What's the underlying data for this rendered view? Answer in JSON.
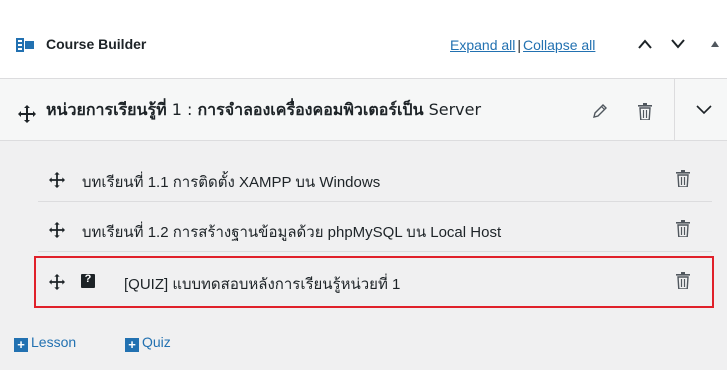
{
  "header": {
    "icon": "course-builder-icon",
    "title": "Course Builder",
    "expand_all": "Expand all",
    "separator": "|",
    "collapse_all": "Collapse all",
    "move_up_icon": "chevron-up-icon",
    "move_down_icon": "chevron-down-icon",
    "collapse_icon": "triangle-up-icon"
  },
  "section": {
    "move_icon": "move-arrows-icon",
    "title_prefix": "หน่วยการเรียนรู้ที่",
    "title_number": " 1 : ",
    "title_main": "การจำลองเครื่องคอมพิวเตอร์เป็น",
    "title_suffix": " Server",
    "edit_icon": "pencil-icon",
    "delete_icon": "trash-icon",
    "toggle_icon": "chevron-down-icon"
  },
  "items": [
    {
      "type": "lesson",
      "label": "บทเรียนที่ 1.1 การติดตั้ง XAMPP บน Windows"
    },
    {
      "type": "lesson",
      "label": "บทเรียนที่ 1.2 การสร้างฐานข้อมูลด้วย phpMySQL บน Local Host"
    },
    {
      "type": "quiz",
      "quiz_badge": "?",
      "label": "[QUIZ] แบบทดสอบหลังการเรียนรู้หน่วยที่ 1"
    }
  ],
  "add": {
    "lesson_label": "Lesson",
    "quiz_label": "Quiz",
    "plus": "+"
  },
  "colors": {
    "link": "#2271b1",
    "highlight": "#e0202a",
    "text": "#1d2327"
  }
}
